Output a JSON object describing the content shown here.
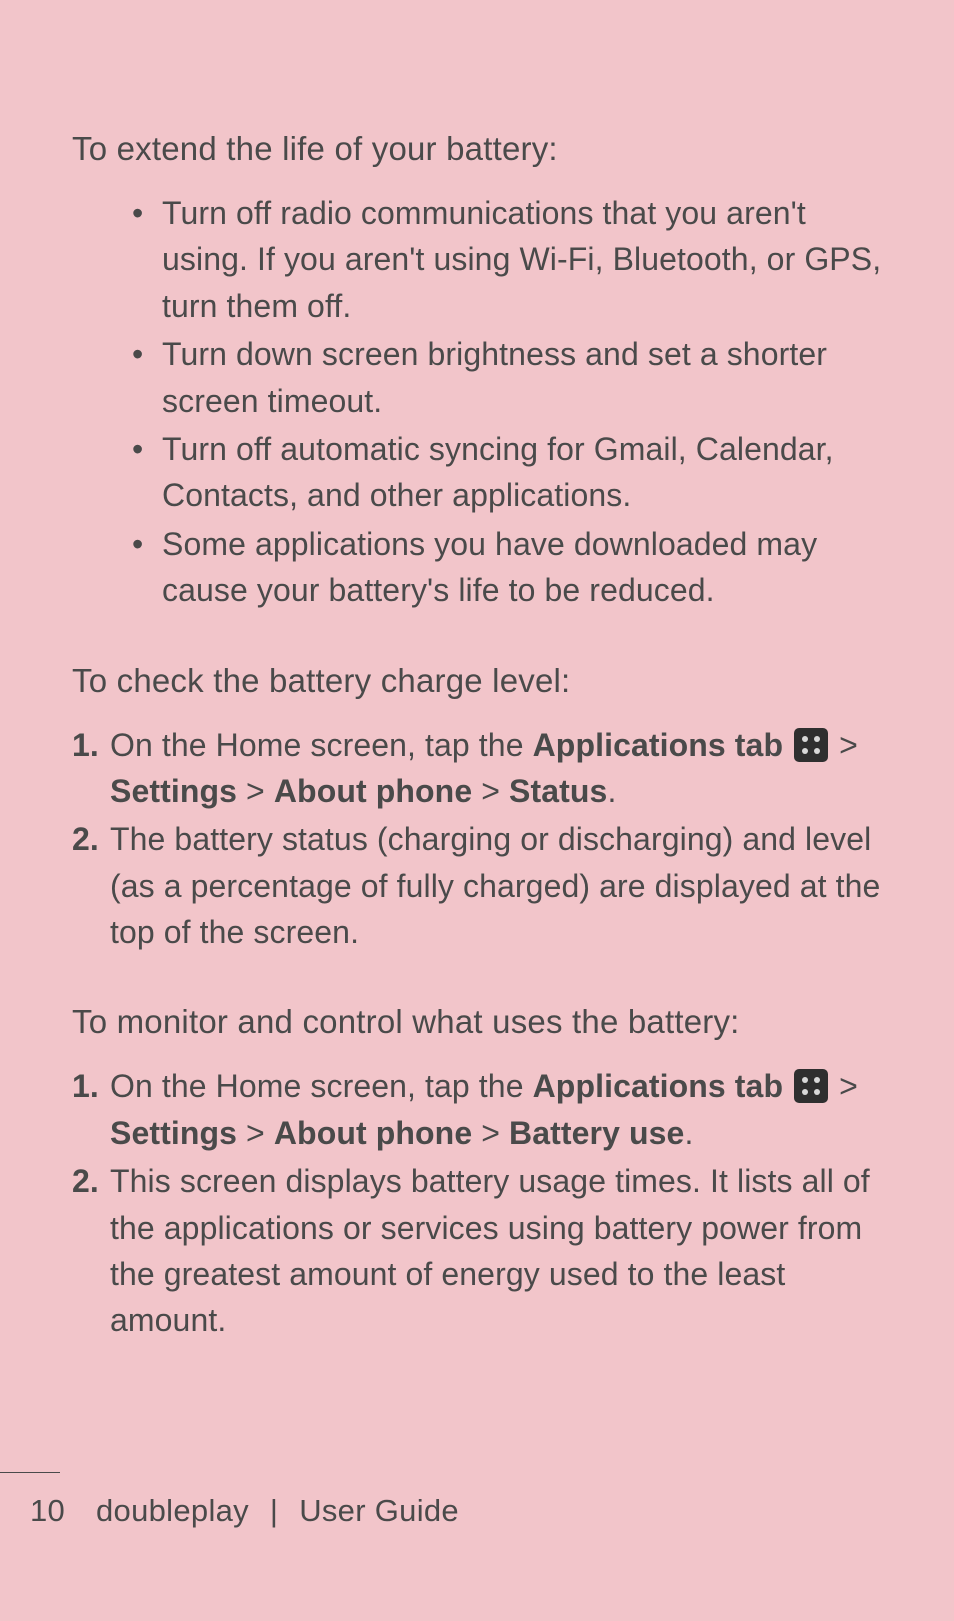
{
  "section1": {
    "heading": "To extend the life of your battery:",
    "bullets": [
      "Turn off radio communications that you aren't using. If you aren't using Wi-Fi, Bluetooth, or GPS, turn them off.",
      "Turn down screen brightness and set a shorter screen timeout.",
      "Turn off automatic syncing for Gmail, Calendar, Contacts, and other applications.",
      "Some applications you have downloaded may cause your battery's life to be reduced."
    ]
  },
  "section2": {
    "heading": "To check the battery charge level:",
    "step1_a": "On the Home screen, tap the ",
    "step1_b": "Applications tab",
    "step1_path": {
      "p1": "Settings",
      "p2": "About phone",
      "p3": "Status"
    },
    "step2": "The battery status (charging or discharging) and level (as a percentage of fully charged) are displayed at the top of the screen."
  },
  "section3": {
    "heading": "To monitor and control what uses the battery:",
    "step1_a": "On the Home screen, tap the ",
    "step1_b": "Applications tab",
    "step1_path": {
      "p1": "Settings",
      "p2": "About phone",
      "p3": "Battery use"
    },
    "step2": "This screen displays battery usage times. It lists all of the applications or services using battery power from the greatest amount of energy used to the least amount."
  },
  "footer": {
    "page": "10",
    "brand": "doubleplay",
    "title": "User Guide"
  },
  "glyphs": {
    "gt": ">",
    "period": "."
  }
}
